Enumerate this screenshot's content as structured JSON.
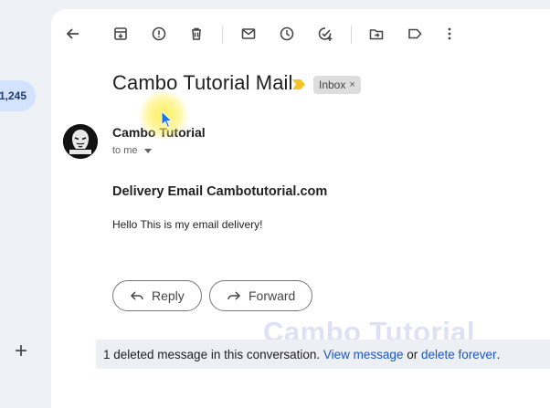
{
  "sidebar": {
    "inbox_count": "1,245",
    "compose_icon": "plus-icon"
  },
  "toolbar": {
    "icons": [
      "back-arrow-icon",
      "archive-icon",
      "report-spam-icon",
      "delete-icon",
      "mark-unread-icon",
      "snooze-icon",
      "add-to-tasks-icon",
      "move-to-icon",
      "label-icon",
      "more-options-icon"
    ]
  },
  "email": {
    "subject": "Cambo Tutorial Mail",
    "label": "Inbox",
    "label_remove": "×",
    "sender": "Cambo Tutorial",
    "recipient": "to me",
    "body_title": "Delivery Email Cambotutorial.com",
    "body_text": "Hello This is my email delivery!"
  },
  "actions": {
    "reply": "Reply",
    "forward": "Forward"
  },
  "watermark": "Cambo Tutorial",
  "notice": {
    "text": "1 deleted message in this conversation.",
    "view_link": "View message",
    "or": "or",
    "delete_link": "delete forever",
    "end": "."
  },
  "colors": {
    "accent_pill": "#d3e3fd",
    "important_marker": "#f7c325",
    "link": "#1a56c4"
  }
}
